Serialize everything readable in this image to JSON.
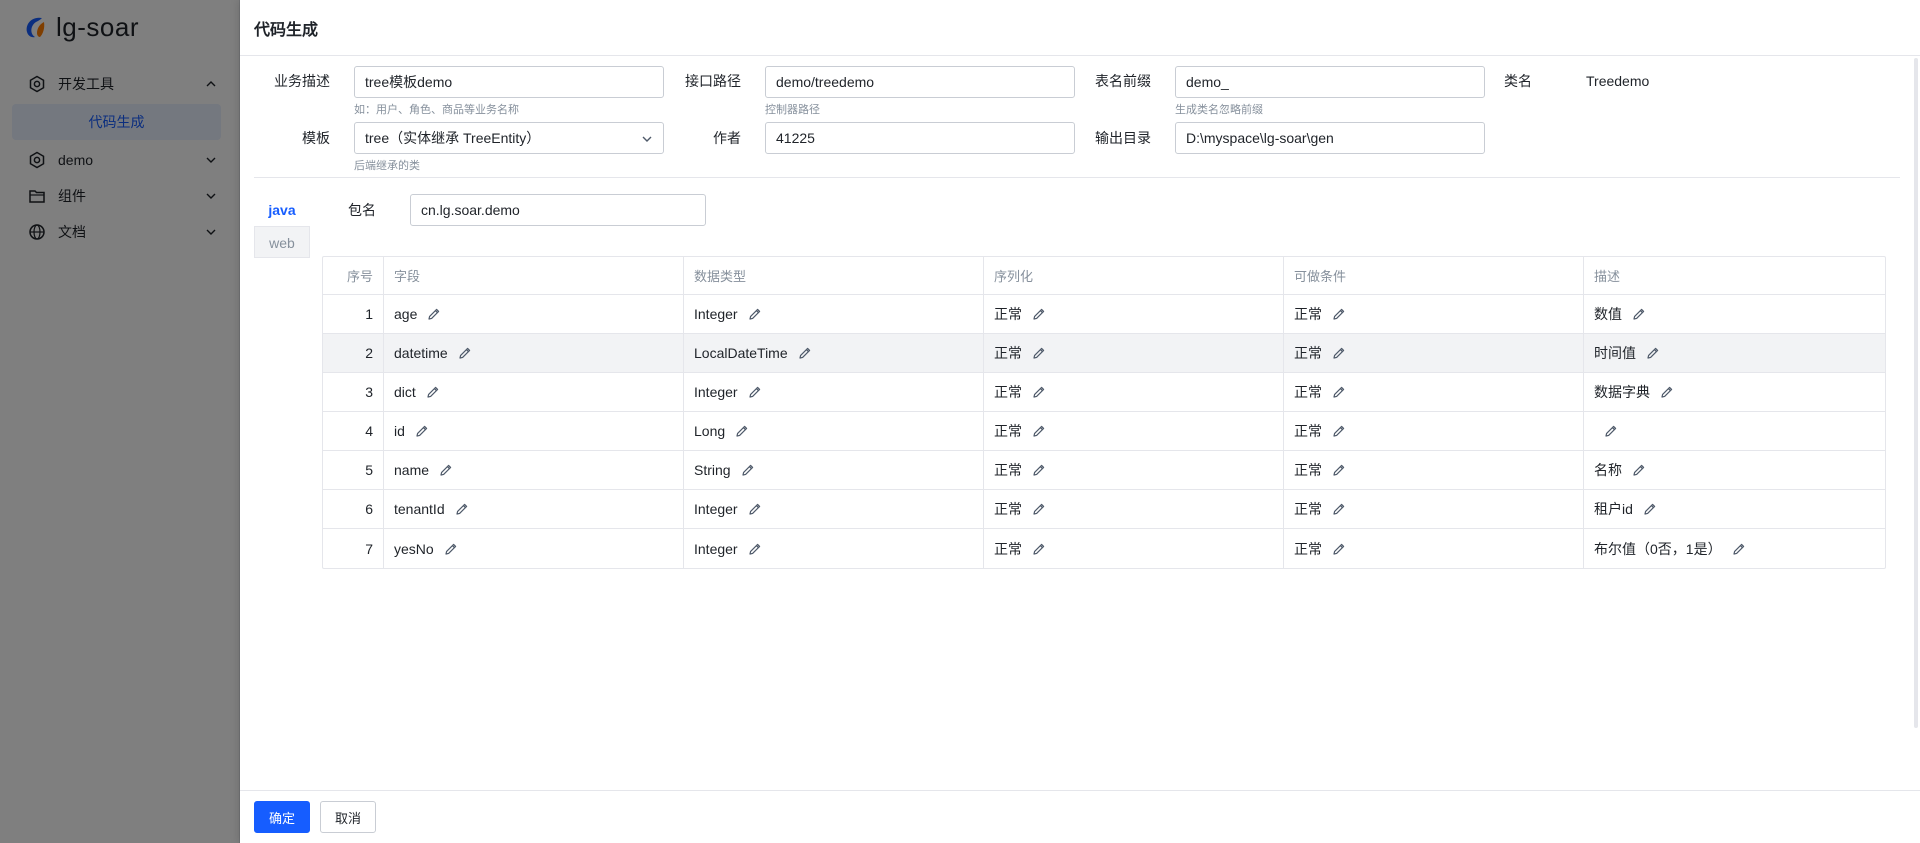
{
  "app": {
    "logo_text": "lg-soar",
    "menu": [
      {
        "label": "开发工具",
        "icon": "settings-icon",
        "expanded": true
      },
      {
        "label": "代码生成",
        "active": true
      },
      {
        "label": "demo",
        "icon": "settings-icon"
      },
      {
        "label": "组件",
        "icon": "folder-icon"
      },
      {
        "label": "文档",
        "icon": "globe-icon"
      }
    ]
  },
  "drawer": {
    "title": "代码生成",
    "form": {
      "business_desc": {
        "label": "业务描述",
        "value": "tree模板demo",
        "help": "如：用户、角色、商品等业务名称"
      },
      "api_path": {
        "label": "接口路径",
        "value": "demo/treedemo",
        "help": "控制器路径"
      },
      "table_prefix": {
        "label": "表名前缀",
        "value": "demo_",
        "help": "生成类名忽略前缀"
      },
      "class_name": {
        "label": "类名",
        "value": "Treedemo"
      },
      "template": {
        "label": "模板",
        "value": "tree（实体继承 TreeEntity）",
        "help": "后端继承的类"
      },
      "author": {
        "label": "作者",
        "value": "41225"
      },
      "output_dir": {
        "label": "输出目录",
        "value": "D:\\myspace\\lg-soar\\gen"
      }
    },
    "tabs": [
      {
        "label": "java",
        "active": true
      },
      {
        "label": "web",
        "active": false
      }
    ],
    "package": {
      "label": "包名",
      "value": "cn.lg.soar.demo"
    },
    "table": {
      "columns": [
        "序号",
        "字段",
        "数据类型",
        "序列化",
        "可做条件",
        "描述"
      ],
      "rows": [
        {
          "idx": "1",
          "field": "age",
          "type": "Integer",
          "serialize": "正常",
          "condition": "正常",
          "desc": "数值"
        },
        {
          "idx": "2",
          "field": "datetime",
          "type": "LocalDateTime",
          "serialize": "正常",
          "condition": "正常",
          "desc": "时间值"
        },
        {
          "idx": "3",
          "field": "dict",
          "type": "Integer",
          "serialize": "正常",
          "condition": "正常",
          "desc": "数据字典"
        },
        {
          "idx": "4",
          "field": "id",
          "type": "Long",
          "serialize": "正常",
          "condition": "正常",
          "desc": ""
        },
        {
          "idx": "5",
          "field": "name",
          "type": "String",
          "serialize": "正常",
          "condition": "正常",
          "desc": "名称"
        },
        {
          "idx": "6",
          "field": "tenantId",
          "type": "Integer",
          "serialize": "正常",
          "condition": "正常",
          "desc": "租户id"
        },
        {
          "idx": "7",
          "field": "yesNo",
          "type": "Integer",
          "serialize": "正常",
          "condition": "正常",
          "desc": "布尔值（0否，1是）"
        }
      ]
    },
    "footer": {
      "confirm": "确定",
      "cancel": "取消"
    }
  },
  "colors": {
    "primary": "#165dff",
    "overlay": "rgba(0,0,0,0.5)",
    "border": "#e5e6eb",
    "muted": "#86909c"
  }
}
